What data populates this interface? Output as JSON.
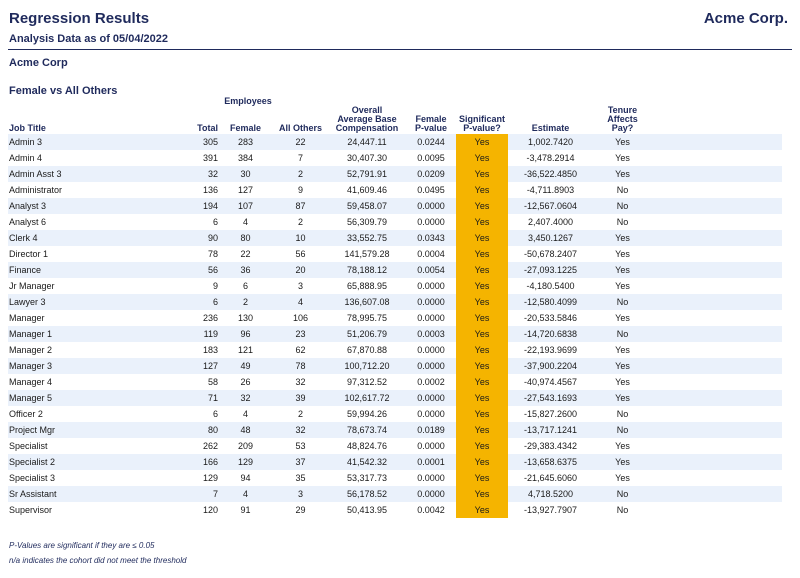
{
  "report": {
    "title": "Regression Results",
    "brand": "Acme Corp.",
    "date": "Analysis Data as of 05/04/2022",
    "company": "Acme Corp",
    "section": "Female vs All Others"
  },
  "table": {
    "group_header": "Employees",
    "headers": {
      "job_title": "Job Title",
      "total": "Total",
      "female": "Female",
      "all_others": "All Others",
      "comp": [
        "Overall",
        "Average Base",
        "Compensation"
      ],
      "pvalue": [
        "Female",
        "P-value"
      ],
      "significant": [
        "Significant",
        "P-value?"
      ],
      "estimate": "Estimate",
      "tenure": [
        "Tenure Affects",
        "Pay?"
      ]
    },
    "highlight_color": "#f5b400",
    "stripe_color": "#eaf1fb",
    "rows": [
      [
        "Admin 3",
        "305",
        "283",
        "22",
        "24,447.11",
        "0.0244",
        "Yes",
        "1,002.7420",
        "Yes"
      ],
      [
        "Admin 4",
        "391",
        "384",
        "7",
        "30,407.30",
        "0.0095",
        "Yes",
        "-3,478.2914",
        "Yes"
      ],
      [
        "Admin Asst 3",
        "32",
        "30",
        "2",
        "52,791.91",
        "0.0209",
        "Yes",
        "-36,522.4850",
        "Yes"
      ],
      [
        "Administrator",
        "136",
        "127",
        "9",
        "41,609.46",
        "0.0495",
        "Yes",
        "-4,711.8903",
        "No"
      ],
      [
        "Analyst 3",
        "194",
        "107",
        "87",
        "59,458.07",
        "0.0000",
        "Yes",
        "-12,567.0604",
        "No"
      ],
      [
        "Analyst 6",
        "6",
        "4",
        "2",
        "56,309.79",
        "0.0000",
        "Yes",
        "2,407.4000",
        "No"
      ],
      [
        "Clerk 4",
        "90",
        "80",
        "10",
        "33,552.75",
        "0.0343",
        "Yes",
        "3,450.1267",
        "Yes"
      ],
      [
        "Director 1",
        "78",
        "22",
        "56",
        "141,579.28",
        "0.0004",
        "Yes",
        "-50,678.2407",
        "Yes"
      ],
      [
        "Finance",
        "56",
        "36",
        "20",
        "78,188.12",
        "0.0054",
        "Yes",
        "-27,093.1225",
        "Yes"
      ],
      [
        "Jr Manager",
        "9",
        "6",
        "3",
        "65,888.95",
        "0.0000",
        "Yes",
        "-4,180.5400",
        "Yes"
      ],
      [
        "Lawyer 3",
        "6",
        "2",
        "4",
        "136,607.08",
        "0.0000",
        "Yes",
        "-12,580.4099",
        "No"
      ],
      [
        "Manager",
        "236",
        "130",
        "106",
        "78,995.75",
        "0.0000",
        "Yes",
        "-20,533.5846",
        "Yes"
      ],
      [
        "Manager 1",
        "119",
        "96",
        "23",
        "51,206.79",
        "0.0003",
        "Yes",
        "-14,720.6838",
        "No"
      ],
      [
        "Manager 2",
        "183",
        "121",
        "62",
        "67,870.88",
        "0.0000",
        "Yes",
        "-22,193.9699",
        "Yes"
      ],
      [
        "Manager 3",
        "127",
        "49",
        "78",
        "100,712.20",
        "0.0000",
        "Yes",
        "-37,900.2204",
        "Yes"
      ],
      [
        "Manager 4",
        "58",
        "26",
        "32",
        "97,312.52",
        "0.0002",
        "Yes",
        "-40,974.4567",
        "Yes"
      ],
      [
        "Manager 5",
        "71",
        "32",
        "39",
        "102,617.72",
        "0.0000",
        "Yes",
        "-27,543.1693",
        "Yes"
      ],
      [
        "Officer 2",
        "6",
        "4",
        "2",
        "59,994.26",
        "0.0000",
        "Yes",
        "-15,827.2600",
        "No"
      ],
      [
        "Project Mgr",
        "80",
        "48",
        "32",
        "78,673.74",
        "0.0189",
        "Yes",
        "-13,717.1241",
        "No"
      ],
      [
        "Specialist",
        "262",
        "209",
        "53",
        "48,824.76",
        "0.0000",
        "Yes",
        "-29,383.4342",
        "Yes"
      ],
      [
        "Specialist 2",
        "166",
        "129",
        "37",
        "41,542.32",
        "0.0001",
        "Yes",
        "-13,658.6375",
        "Yes"
      ],
      [
        "Specialist 3",
        "129",
        "94",
        "35",
        "53,317.73",
        "0.0000",
        "Yes",
        "-21,645.6060",
        "Yes"
      ],
      [
        "Sr Assistant",
        "7",
        "4",
        "3",
        "56,178.52",
        "0.0000",
        "Yes",
        "4,718.5200",
        "No"
      ],
      [
        "Supervisor",
        "120",
        "91",
        "29",
        "50,413.95",
        "0.0042",
        "Yes",
        "-13,927.7907",
        "No"
      ]
    ]
  },
  "footnotes": {
    "pvalue_note": "P-Values are significant if they are ≤ 0.05",
    "na_note": "n/a indicates the cohort did not meet the threshold"
  }
}
